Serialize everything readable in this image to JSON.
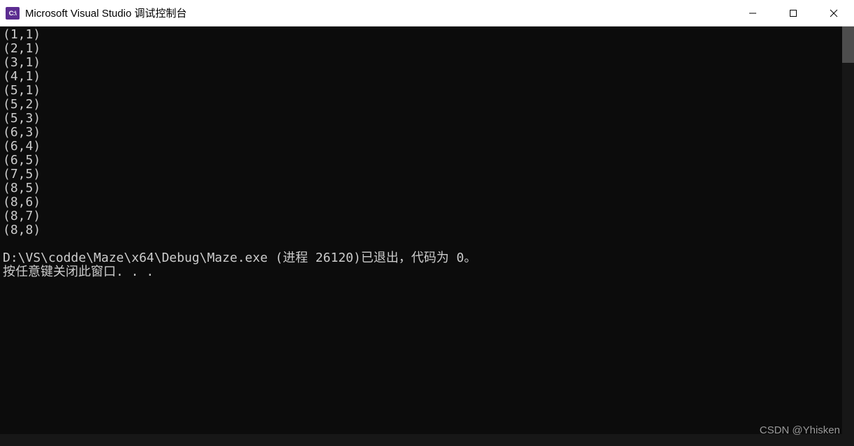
{
  "window": {
    "icon_text": "C:\\",
    "title": "Microsoft Visual Studio 调试控制台"
  },
  "console": {
    "coords": [
      "(1,1)",
      "(2,1)",
      "(3,1)",
      "(4,1)",
      "(5,1)",
      "(5,2)",
      "(5,3)",
      "(6,3)",
      "(6,4)",
      "(6,5)",
      "(7,5)",
      "(8,5)",
      "(8,6)",
      "(8,7)",
      "(8,8)"
    ],
    "blank": "",
    "exit_line": "D:\\VS\\codde\\Maze\\x64\\Debug\\Maze.exe (进程 26120)已退出，代码为 0。",
    "prompt_line": "按任意键关闭此窗口. . ."
  },
  "watermark": "CSDN @Yhisken"
}
